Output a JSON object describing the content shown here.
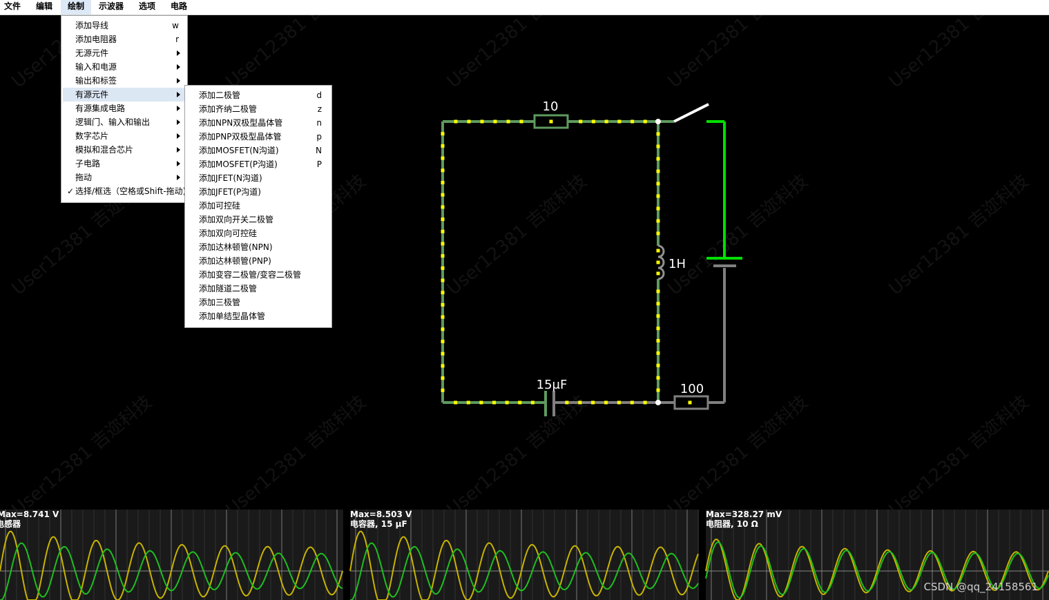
{
  "menubar": {
    "items": [
      "文件",
      "编辑",
      "绘制",
      "示波器",
      "选项",
      "电路"
    ],
    "active_index": 2
  },
  "draw_menu": {
    "items": [
      {
        "label": "添加导线",
        "shortcut": "w"
      },
      {
        "label": "添加电阻器",
        "shortcut": "r"
      },
      {
        "label": "无源元件",
        "submenu": true
      },
      {
        "label": "输入和电源",
        "submenu": true
      },
      {
        "label": "输出和标签",
        "submenu": true
      },
      {
        "label": "有源元件",
        "submenu": true,
        "highlighted": true
      },
      {
        "label": "有源集成电路",
        "submenu": true
      },
      {
        "label": "逻辑门、输入和输出",
        "submenu": true
      },
      {
        "label": "数字芯片",
        "submenu": true
      },
      {
        "label": "模拟和混合芯片",
        "submenu": true
      },
      {
        "label": "子电路",
        "submenu": true
      },
      {
        "label": "拖动",
        "submenu": true
      },
      {
        "label": "选择/框选（空格或Shift-拖动)",
        "checked": true
      }
    ]
  },
  "active_submenu": {
    "items": [
      {
        "label": "添加二极管",
        "shortcut": "d"
      },
      {
        "label": "添加齐纳二极管",
        "shortcut": "z"
      },
      {
        "label": "添加NPN双极型晶体管",
        "shortcut": "n"
      },
      {
        "label": "添加PNP双极型晶体管",
        "shortcut": "p"
      },
      {
        "label": "添加MOSFET(N沟道)",
        "shortcut": "N"
      },
      {
        "label": "添加MOSFET(P沟道)",
        "shortcut": "P"
      },
      {
        "label": "添加JFET(N沟道)"
      },
      {
        "label": "添加JFET(P沟道)"
      },
      {
        "label": "添加可控硅"
      },
      {
        "label": "添加双向开关二极管"
      },
      {
        "label": "添加双向可控硅"
      },
      {
        "label": "添加达林顿管(NPN)"
      },
      {
        "label": "添加达林顿管(PNP)"
      },
      {
        "label": "添加变容二极管/变容二极管"
      },
      {
        "label": "添加隧道二极管"
      },
      {
        "label": "添加三极管"
      },
      {
        "label": "添加单结型晶体管"
      }
    ]
  },
  "circuit": {
    "resistor_top_label": "10",
    "inductor_label": "1H",
    "capacitor_label": "15μF",
    "resistor_bottom_label": "100",
    "colors": {
      "active_wire": "#5e9a5e",
      "current_dot": "#ffff00",
      "inactive": "#808080",
      "source": "#00e000"
    }
  },
  "scopes": [
    {
      "max_label": "Max=8.741 V",
      "name_label": "电感器"
    },
    {
      "max_label": "Max=8.503 V",
      "name_label": "电容器, 15 μF"
    },
    {
      "max_label": "Max=328.27 mV",
      "name_label": "电阻器, 10 Ω"
    }
  ],
  "scope_colors": {
    "voltage": "#c8b400",
    "current": "#1fbf1f"
  },
  "watermark": {
    "text_user": "User12381",
    "text_company": "吉迩科技"
  },
  "footer": {
    "csdn_credit": "CSDN @qq_24158561"
  }
}
